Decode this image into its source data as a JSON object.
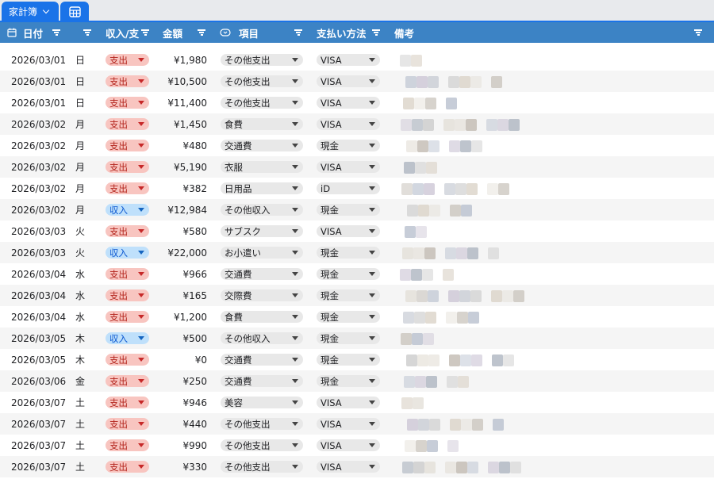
{
  "sheet_tabs": {
    "active_tab": "家計簿"
  },
  "header": {
    "date": "日付",
    "type": "収入/支",
    "amount": "金額",
    "category": "項目",
    "payment": "支払い方法",
    "note": "備考"
  },
  "rows": [
    {
      "date": "2026/03/01",
      "day": "日",
      "type": "支出",
      "amount": "¥1,980",
      "category": "その他支出",
      "payment": "VISA"
    },
    {
      "date": "2026/03/01",
      "day": "日",
      "type": "支出",
      "amount": "¥10,500",
      "category": "その他支出",
      "payment": "VISA"
    },
    {
      "date": "2026/03/01",
      "day": "日",
      "type": "支出",
      "amount": "¥11,400",
      "category": "その他支出",
      "payment": "VISA"
    },
    {
      "date": "2026/03/02",
      "day": "月",
      "type": "支出",
      "amount": "¥1,450",
      "category": "食費",
      "payment": "VISA"
    },
    {
      "date": "2026/03/02",
      "day": "月",
      "type": "支出",
      "amount": "¥480",
      "category": "交通費",
      "payment": "現金"
    },
    {
      "date": "2026/03/02",
      "day": "月",
      "type": "支出",
      "amount": "¥5,190",
      "category": "衣服",
      "payment": "VISA"
    },
    {
      "date": "2026/03/02",
      "day": "月",
      "type": "支出",
      "amount": "¥382",
      "category": "日用品",
      "payment": "iD"
    },
    {
      "date": "2026/03/02",
      "day": "月",
      "type": "収入",
      "amount": "¥12,984",
      "category": "その他収入",
      "payment": "現金"
    },
    {
      "date": "2026/03/03",
      "day": "火",
      "type": "支出",
      "amount": "¥580",
      "category": "サブスク",
      "payment": "VISA"
    },
    {
      "date": "2026/03/03",
      "day": "火",
      "type": "収入",
      "amount": "¥22,000",
      "category": "お小遣い",
      "payment": "現金"
    },
    {
      "date": "2026/03/04",
      "day": "水",
      "type": "支出",
      "amount": "¥966",
      "category": "交通費",
      "payment": "現金"
    },
    {
      "date": "2026/03/04",
      "day": "水",
      "type": "支出",
      "amount": "¥165",
      "category": "交際費",
      "payment": "現金"
    },
    {
      "date": "2026/03/04",
      "day": "水",
      "type": "支出",
      "amount": "¥1,200",
      "category": "食費",
      "payment": "現金"
    },
    {
      "date": "2026/03/05",
      "day": "木",
      "type": "収入",
      "amount": "¥500",
      "category": "その他収入",
      "payment": "現金"
    },
    {
      "date": "2026/03/05",
      "day": "木",
      "type": "支出",
      "amount": "¥0",
      "category": "交通費",
      "payment": "現金"
    },
    {
      "date": "2026/03/06",
      "day": "金",
      "type": "支出",
      "amount": "¥250",
      "category": "交通費",
      "payment": "現金"
    },
    {
      "date": "2026/03/07",
      "day": "土",
      "type": "支出",
      "amount": "¥946",
      "category": "美容",
      "payment": "VISA"
    },
    {
      "date": "2026/03/07",
      "day": "土",
      "type": "支出",
      "amount": "¥440",
      "category": "その他支出",
      "payment": "VISA"
    },
    {
      "date": "2026/03/07",
      "day": "土",
      "type": "支出",
      "amount": "¥990",
      "category": "その他支出",
      "payment": "VISA"
    },
    {
      "date": "2026/03/07",
      "day": "土",
      "type": "支出",
      "amount": "¥330",
      "category": "その他支出",
      "payment": "VISA"
    }
  ],
  "colors": {
    "header_bg": "#3c83c5",
    "tab_active": "#1a73e8",
    "expense_chip": "#f8c5c0",
    "expense_text": "#b3261e",
    "income_chip": "#bfe0fb",
    "income_text": "#0b57d0"
  }
}
